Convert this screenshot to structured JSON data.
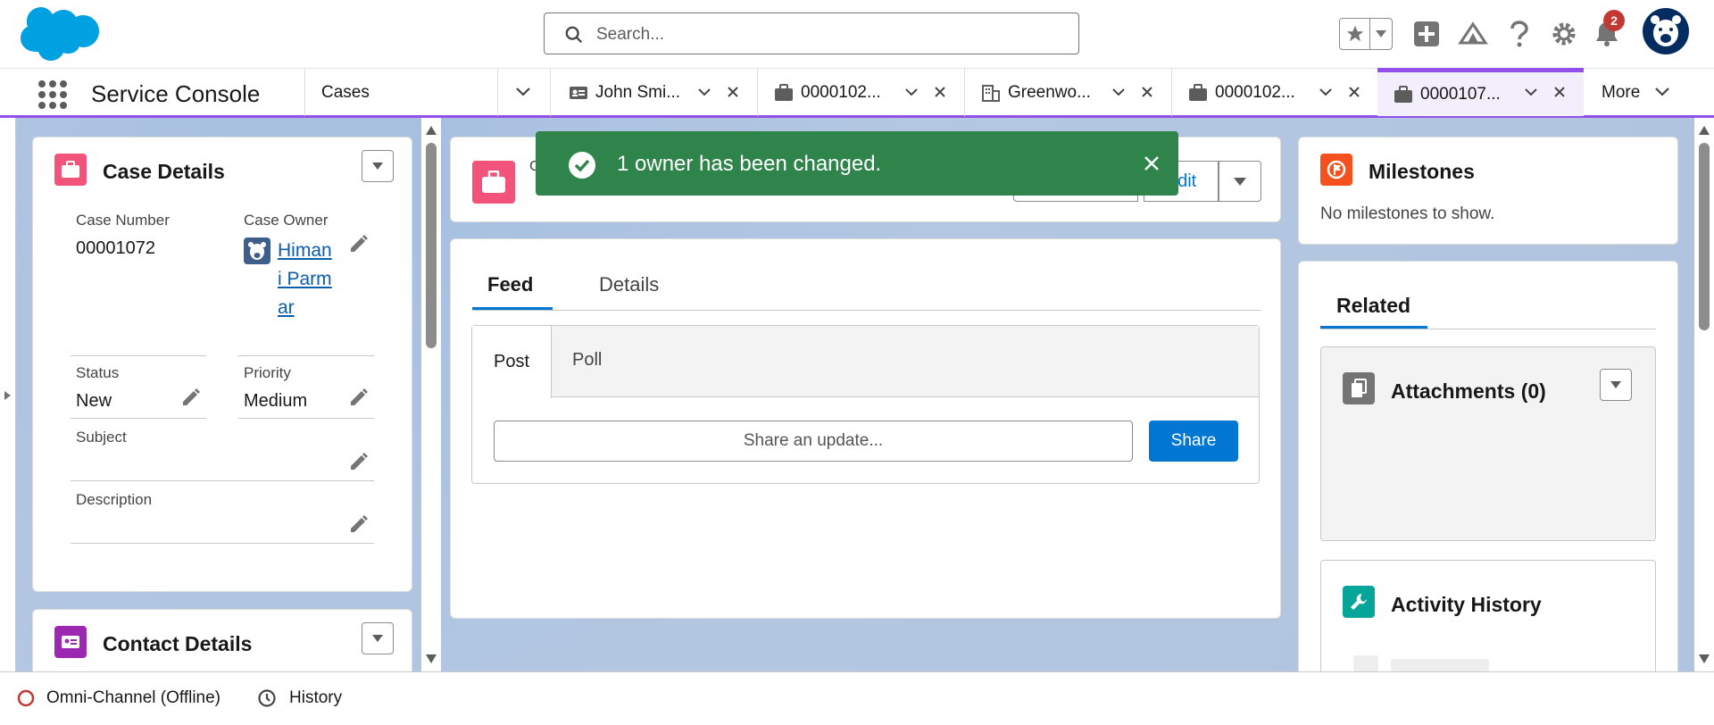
{
  "header": {
    "search_placeholder": "Search...",
    "notifications_count": "2"
  },
  "navbar": {
    "app_name": "Service Console",
    "object_tab": "Cases",
    "tabs": [
      {
        "label": "John Smi...",
        "icon": "contact-card-icon"
      },
      {
        "label": "0000102...",
        "icon": "briefcase-icon"
      },
      {
        "label": "Greenwo...",
        "icon": "building-icon"
      },
      {
        "label": "0000102...",
        "icon": "briefcase-icon"
      },
      {
        "label": "0000107...",
        "icon": "briefcase-icon",
        "active": true
      }
    ],
    "more_label": "More"
  },
  "toast": {
    "message": "1 owner has been changed.",
    "color": "#2e844a"
  },
  "case_details": {
    "title": "Case Details",
    "case_number_label": "Case Number",
    "case_number": "00001072",
    "case_owner_label": "Case Owner",
    "case_owner": "Himani Parmar",
    "status_label": "Status",
    "status": "New",
    "priority_label": "Priority",
    "priority": "Medium",
    "subject_label": "Subject",
    "description_label": "Description"
  },
  "contact_details": {
    "title": "Contact Details"
  },
  "highlights": {
    "title_fragment": "C",
    "edit_label": "Edit"
  },
  "feed": {
    "tabs": [
      "Feed",
      "Details"
    ],
    "publisher_tabs": [
      "Post",
      "Poll"
    ],
    "share_placeholder": "Share an update...",
    "share_button": "Share"
  },
  "milestones": {
    "title": "Milestones",
    "empty_text": "No milestones to show."
  },
  "related": {
    "tab_label": "Related",
    "attachments_title": "Attachments (0)",
    "activity_title": "Activity History"
  },
  "utility_bar": {
    "omni_channel": "Omni-Channel (Offline)",
    "history": "History"
  },
  "colors": {
    "brand_blue": "#0176d3",
    "accent_purple": "#9050e9",
    "case_pink": "#f2537a"
  }
}
